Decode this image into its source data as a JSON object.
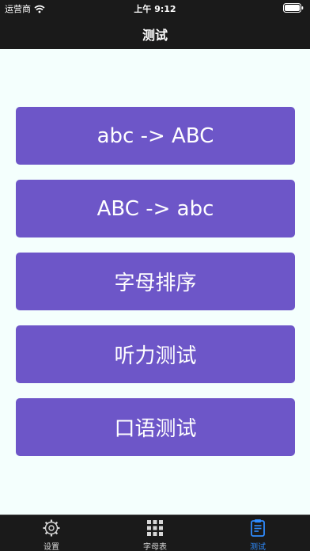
{
  "status": {
    "carrier": "运营商",
    "time": "上午 9:12"
  },
  "nav": {
    "title": "测试"
  },
  "buttons": [
    {
      "label": "abc -> ABC"
    },
    {
      "label": "ABC -> abc"
    },
    {
      "label": "字母排序"
    },
    {
      "label": "听力测试"
    },
    {
      "label": "口语测试"
    }
  ],
  "tabbar": {
    "items": [
      {
        "label": "设置",
        "icon": "gear-icon"
      },
      {
        "label": "字母表",
        "icon": "grid-icon"
      },
      {
        "label": "测试",
        "icon": "clipboard-icon",
        "active": true
      }
    ],
    "active_color": "#2f8cff"
  },
  "colors": {
    "accent": "#6d56c8",
    "background": "#f4fffd",
    "bar": "#1a1a1a"
  }
}
